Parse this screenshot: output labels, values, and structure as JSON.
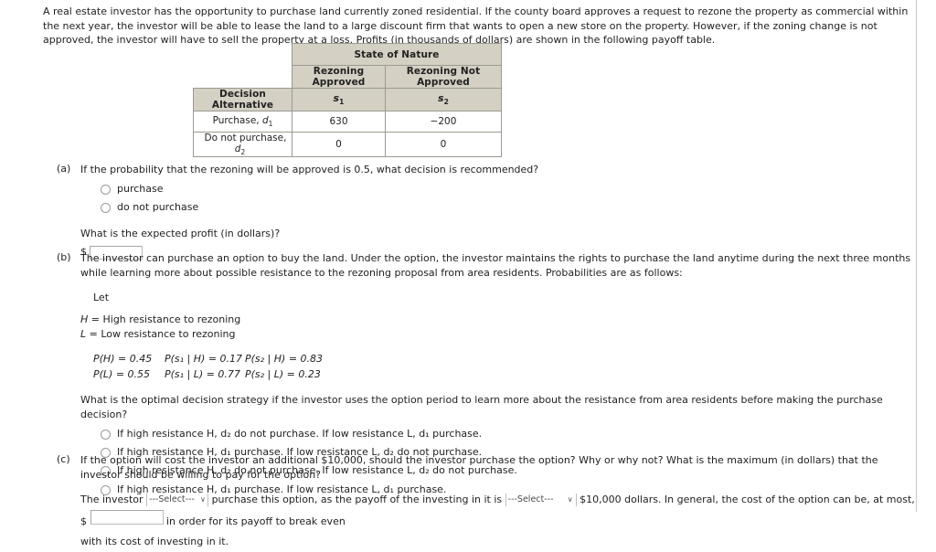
{
  "intro": "A real estate investor has the opportunity to purchase land currently zoned residential. If the county board approves a request to rezone the property as commercial within the next year, the investor will be able to lease the land to a large discount firm that wants to open a new store on the property. However, if the zoning change is not approved, the investor will have to sell the property at a loss. Profits (in thousands of dollars) are shown in the following payoff table.",
  "payoff_table": {
    "state_of_nature_header": "State of Nature",
    "state_headers": [
      "Rezoning Approved",
      "Rezoning Not Approved"
    ],
    "state_symbols": [
      "s",
      "s"
    ],
    "state_symbol_subs": [
      "1",
      "2"
    ],
    "decision_header": "Decision Alternative",
    "rows": [
      {
        "label_text": "Purchase, ",
        "label_symbol": "d",
        "label_sub": "1",
        "values": [
          "630",
          "−200"
        ]
      },
      {
        "label_text": "Do not purchase, ",
        "label_symbol": "d",
        "label_sub": "2",
        "values": [
          "0",
          "0"
        ]
      }
    ]
  },
  "part_a": {
    "label": "(a)",
    "question": "If the probability that the rezoning will be approved is 0.5, what decision is recommended?",
    "options": [
      "purchase",
      "do not purchase"
    ],
    "sub_question": "What is the expected profit (in dollars)?",
    "currency_symbol": "$",
    "answer_value": ""
  },
  "part_b": {
    "label": "(b)",
    "intro": "The investor can purchase an option to buy the land. Under the option, the investor maintains the rights to purchase the land anytime during the next three months while learning more about possible resistance to the rezoning proposal from area residents. Probabilities are as follows:",
    "let_word": "Let",
    "definitions": [
      {
        "symbol": "H",
        "text": " = High resistance to rezoning"
      },
      {
        "symbol": "L",
        "text": " = Low resistance to rezoning"
      }
    ],
    "probabilities": [
      [
        "P(H) = 0.45",
        "P(s₁ | H) = 0.17",
        "P(s₂ | H) = 0.83"
      ],
      [
        "P(L) = 0.55",
        "P(s₁ | L) = 0.77",
        "P(s₂ | L) = 0.23"
      ]
    ],
    "question": "What is the optimal decision strategy if the investor uses the option period to learn more about the resistance from area residents before making the purchase decision?",
    "options": [
      "If high resistance H, d₂ do not purchase. If low resistance L, d₁ purchase.",
      "If high resistance H, d₁ purchase. If low resistance L, d₂ do not purchase.",
      "If high resistance H, d₂ do not purchase. If low resistance L, d₂ do not purchase.",
      "If high resistance H, d₁ purchase. If low resistance L, d₁ purchase."
    ]
  },
  "part_c": {
    "label": "(c)",
    "question": "If the option will cost the investor an additional $10,000, should the investor purchase the option? Why or why not? What is the maximum (in dollars) that the investor should be willing to pay for the option?",
    "sentence_start": "The investor",
    "select_placeholder": "---Select---",
    "chevron": "∨",
    "sentence_mid": "purchase this option, as the payoff of the investing in it is",
    "sentence_after_second_select": "$10,000 dollars. In general, the cost of the option can be, at most, $",
    "sentence_end": "in order for its payoff to break even",
    "sentence_last_line": "with its cost of investing in it.",
    "answer_value": ""
  }
}
